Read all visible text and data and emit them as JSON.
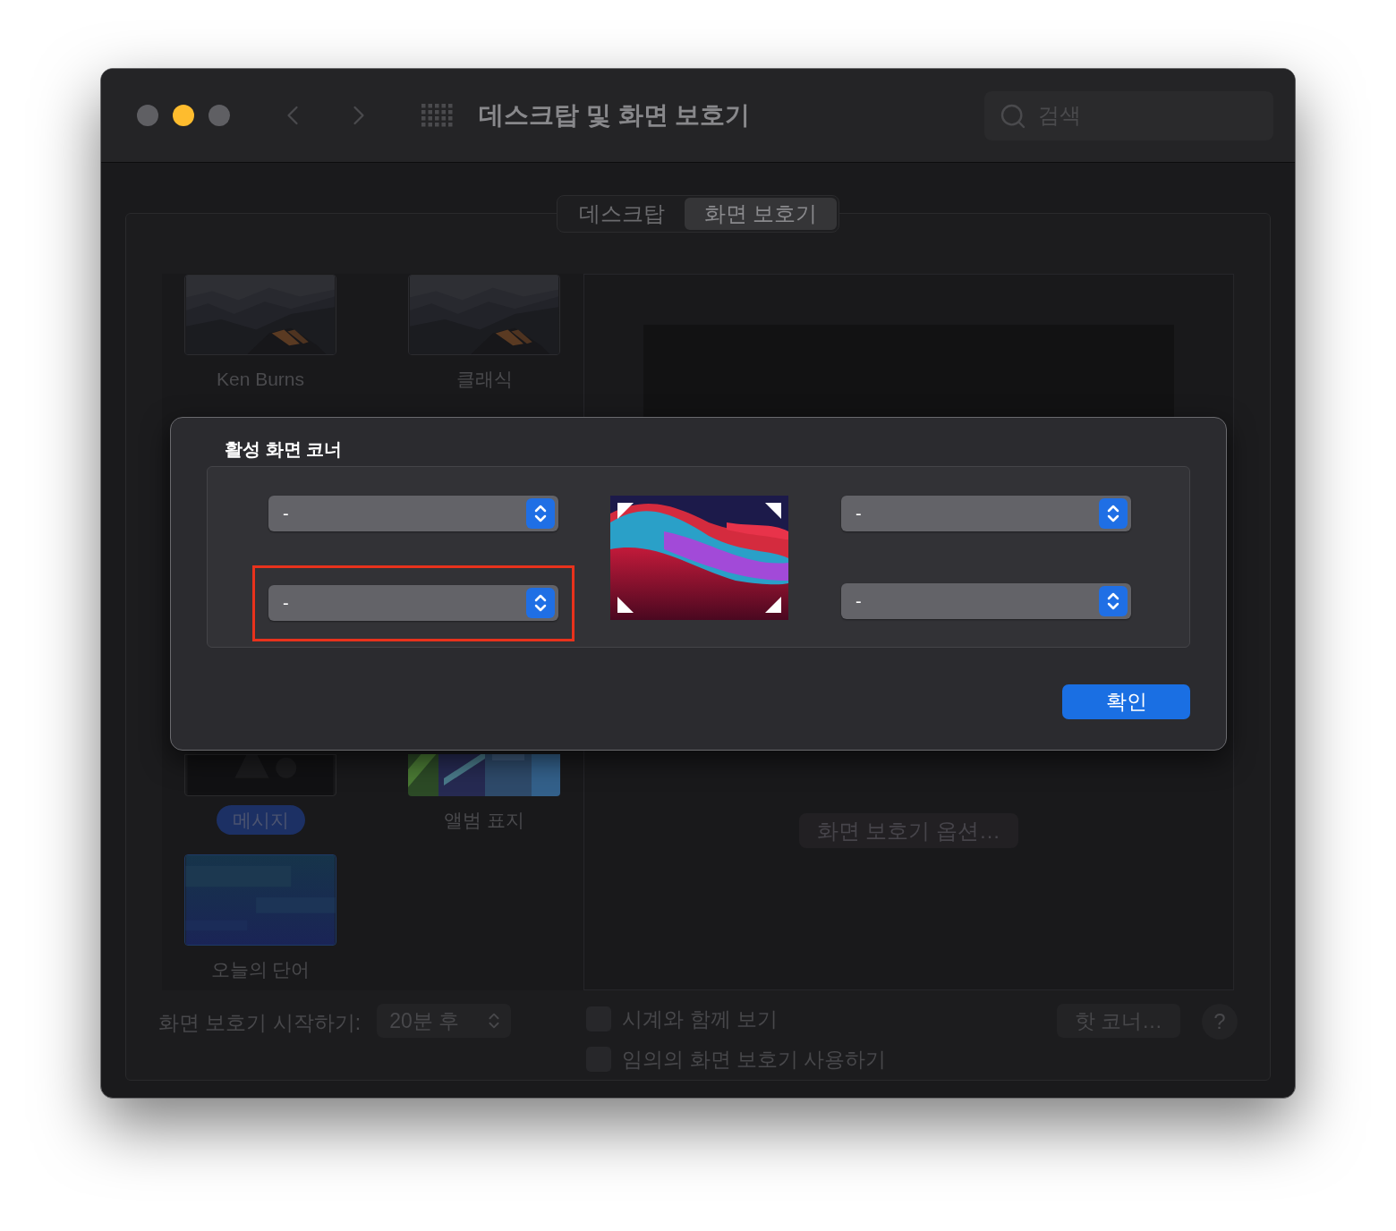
{
  "window": {
    "title": "데스크탑 및 화면 보호기",
    "traffic_lights": [
      {
        "color": "#5f5f63"
      },
      {
        "color": "#febc2e"
      },
      {
        "color": "#5f5f63"
      }
    ]
  },
  "search": {
    "placeholder": "검색"
  },
  "tabs": [
    {
      "label": "데스크탑",
      "selected": false
    },
    {
      "label": "화면 보호기",
      "selected": true
    }
  ],
  "screen_savers": [
    {
      "label": "Ken Burns",
      "selected": false
    },
    {
      "label": "클래식",
      "selected": false
    },
    {
      "label": "메시지",
      "selected": true
    },
    {
      "label": "앨범 표지",
      "selected": false
    },
    {
      "label": "오늘의 단어",
      "selected": false
    }
  ],
  "preview": {
    "options_button": "화면 보호기 옵션…"
  },
  "start_after": {
    "label": "화면 보호기 시작하기:",
    "value": "20분 후"
  },
  "checkboxes": [
    {
      "label": "시계와 함께 보기",
      "checked": false
    },
    {
      "label": "임의의 화면 보호기 사용하기",
      "checked": false
    }
  ],
  "hot_corners_button": "핫 코너…",
  "help_button": "?",
  "sheet": {
    "title": "활성 화면 코너",
    "corners": [
      {
        "value": "-",
        "highlighted": false
      },
      {
        "value": "-",
        "highlighted": false
      },
      {
        "value": "-",
        "highlighted": true
      },
      {
        "value": "-",
        "highlighted": false
      }
    ],
    "confirm_button": "확인"
  }
}
